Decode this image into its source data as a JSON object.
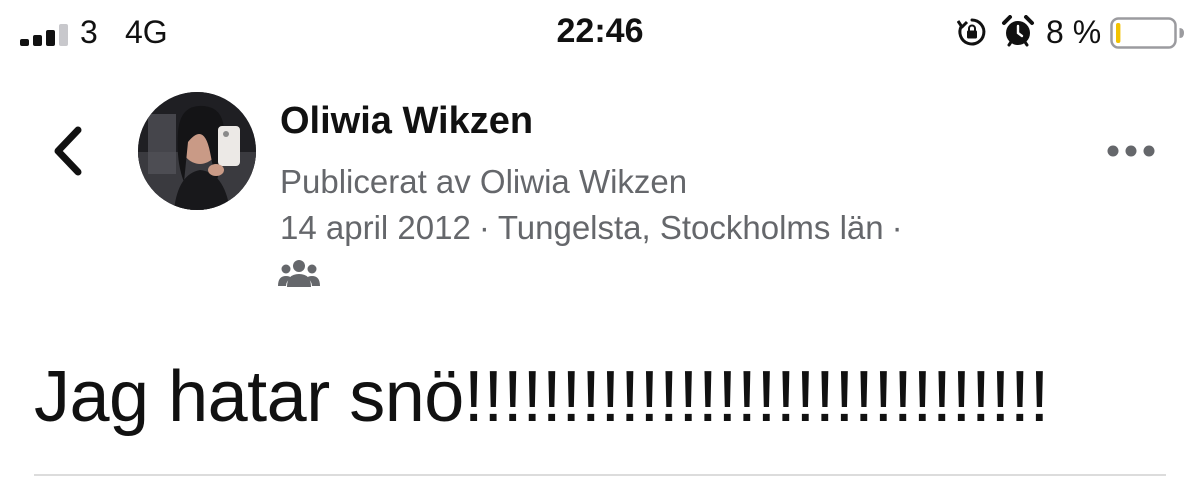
{
  "status_bar": {
    "carrier": "3",
    "network": "4G",
    "time": "22:46",
    "battery_percent": "8 %",
    "battery_level": 0.08,
    "icons": [
      "signal-icon",
      "rotation-lock-icon",
      "alarm-icon",
      "battery-icon"
    ]
  },
  "post": {
    "author_name": "Oliwia Wikzen",
    "published_by": "Publicerat av Oliwia Wikzen",
    "date": "14 april 2012",
    "separator": "·",
    "location": "Tungelsta, Stockholms län",
    "audience_icon": "friends-icon",
    "text": "Jag hatar snö!!!!!!!!!!!!!!!!!!!!!!!!!!!!!!"
  },
  "colors": {
    "text": "#111111",
    "secondary_text": "#65676b",
    "battery_low": "#f2c200",
    "divider": "#dcdcdc"
  }
}
